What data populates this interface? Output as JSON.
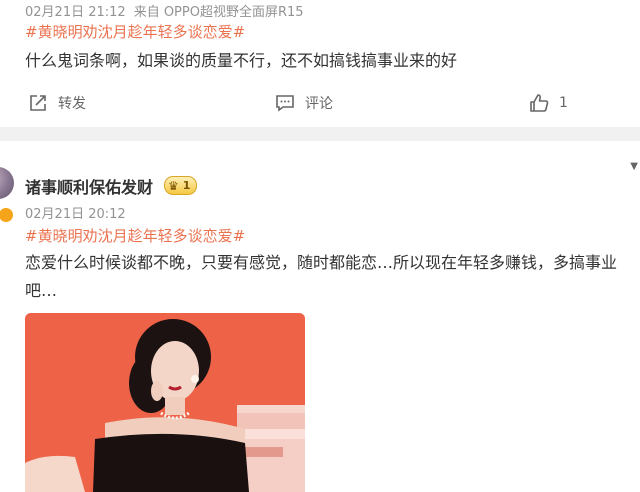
{
  "post1": {
    "date": "02月21日 21:12",
    "source": "来自 OPPO超视野全面屏R15",
    "hashtag": "#黄晓明劝沈月趁年轻多谈恋爱#",
    "content": "什么鬼词条啊，如果谈的质量不行，还不如搞钱搞事业来的好",
    "repost_label": "转发",
    "comment_label": "评论",
    "like_count": "1"
  },
  "post2": {
    "username": "诸事顺利保佑发财",
    "level": "1",
    "date": "02月21日 20:12",
    "hashtag": "#黄晓明劝沈月趁年轻多谈恋爱#",
    "content": "恋爱什么时候谈都不晚，只要有感觉，随时都能恋…所以现在年轻多赚钱，多搞事业吧…"
  },
  "colors": {
    "hashtag": "#eb7350",
    "meta": "#939393",
    "text": "#333333",
    "separator": "#f1f1f1",
    "photo_bg": "#ee5f45"
  },
  "icons": [
    "repost-icon",
    "comment-icon",
    "like-icon",
    "crown-icon",
    "chevron-down-icon"
  ]
}
